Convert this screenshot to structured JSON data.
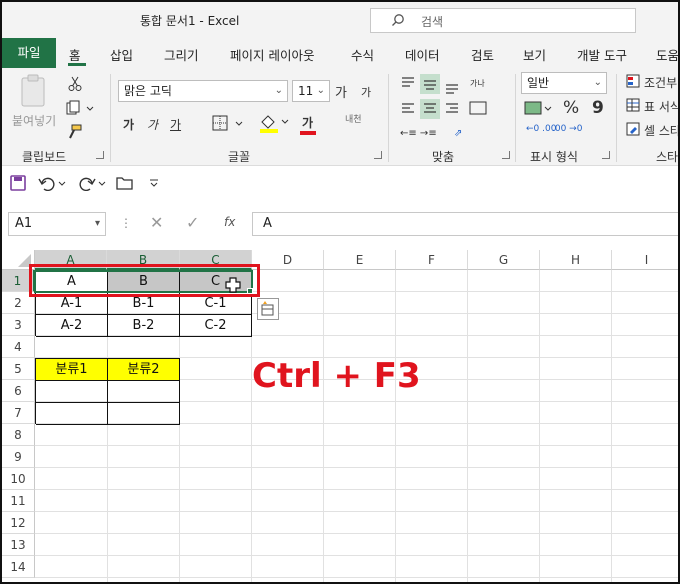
{
  "titlebar": {
    "title": "통합 문서1  -  Excel",
    "search_placeholder": "검색"
  },
  "tabs": [
    "파일",
    "홈",
    "삽입",
    "그리기",
    "페이지 레이아웃",
    "수식",
    "데이터",
    "검토",
    "보기",
    "개발 도구",
    "도움"
  ],
  "ribbon": {
    "paste_label": "붙여넣기",
    "font_name": "맑은 고딕",
    "font_size": "11",
    "grow_font": "가",
    "shrink_font": "가",
    "bold": "가",
    "italic": "가",
    "underline": "가",
    "font_color_glyph": "가",
    "phonetic": "내천",
    "number_format": "일반",
    "percent": "%",
    "comma": "9",
    "cond_format": "조건부",
    "table_format": "표 서식",
    "cell_styles": "셀 스타",
    "groups": {
      "clipboard": "클립보드",
      "font": "글꼴",
      "alignment": "맞춤",
      "number": "표시 형식",
      "styles": "스타"
    }
  },
  "formula_bar": {
    "name_box": "A1",
    "fx": "fx",
    "content": "A"
  },
  "columns": [
    "A",
    "B",
    "C",
    "D",
    "E",
    "F",
    "G",
    "H",
    "I"
  ],
  "rows": [
    "1",
    "2",
    "3",
    "4",
    "5",
    "6",
    "7",
    "8",
    "9",
    "10",
    "11",
    "12",
    "13",
    "14"
  ],
  "cells": {
    "A1": "A",
    "B1": "B",
    "C1": "C",
    "A2": "A-1",
    "B2": "B-1",
    "C2": "C-1",
    "A3": "A-2",
    "B3": "B-2",
    "C3": "C-2",
    "A5": "분류1",
    "B5": "분류2"
  },
  "annotation": "Ctrl + F3",
  "colors": {
    "accent": "#217346",
    "highlight_box": "#e0141e",
    "yellow": "#ffff00",
    "annotation": "#e0141e"
  }
}
